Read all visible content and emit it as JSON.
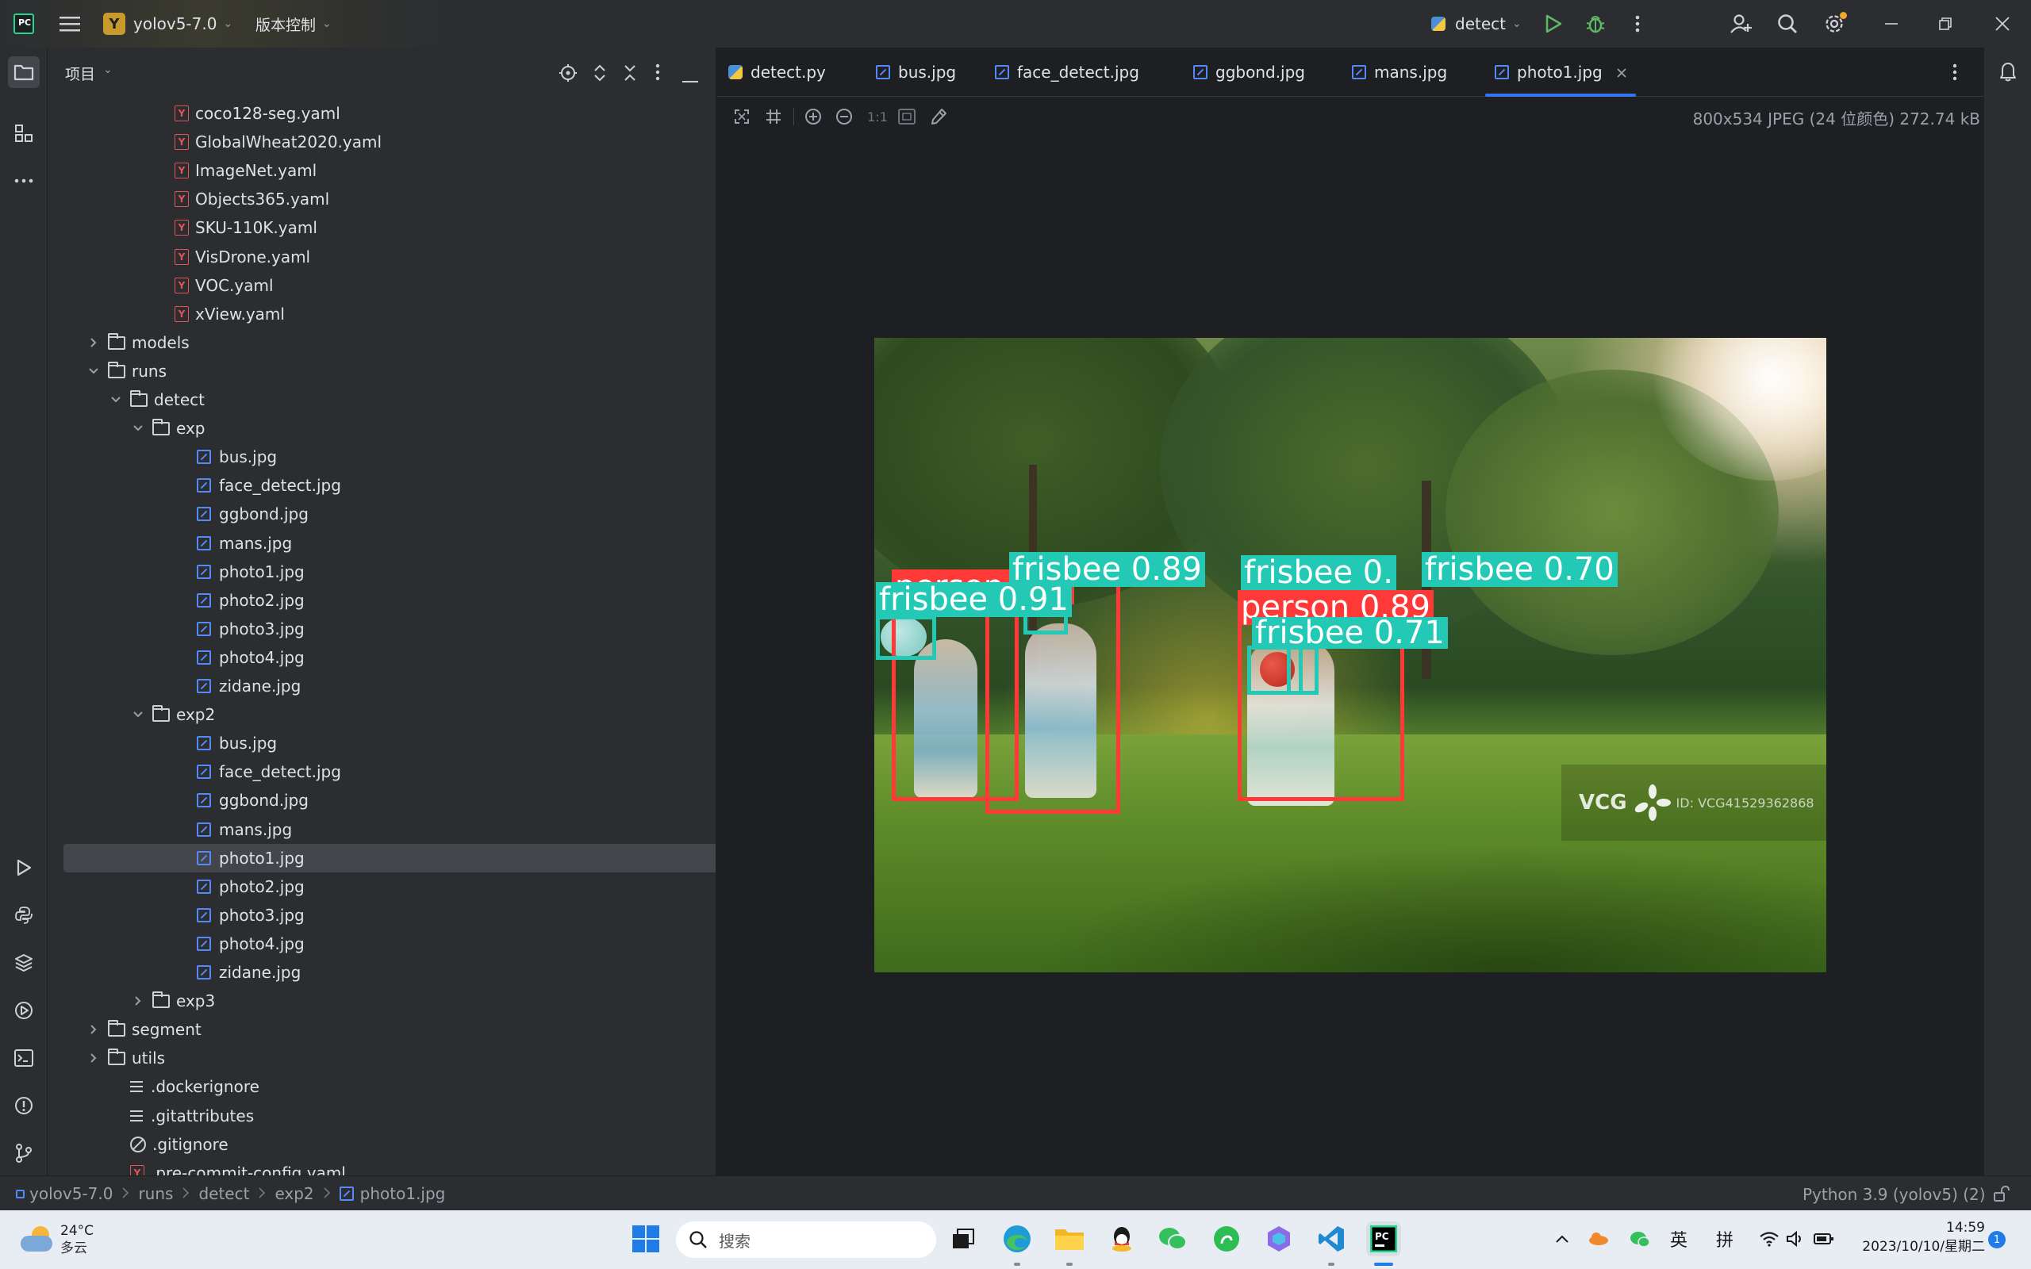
{
  "titlebar": {
    "project_initial": "Y",
    "project_name": "yolov5-7.0",
    "vcs_label": "版本控制",
    "run_config": "detect"
  },
  "project_panel": {
    "title": "项目",
    "tree": [
      {
        "label": "coco128-seg.yaml",
        "type": "yaml",
        "indent": 4
      },
      {
        "label": "GlobalWheat2020.yaml",
        "type": "yaml",
        "indent": 4
      },
      {
        "label": "ImageNet.yaml",
        "type": "yaml",
        "indent": 4
      },
      {
        "label": "Objects365.yaml",
        "type": "yaml",
        "indent": 4
      },
      {
        "label": "SKU-110K.yaml",
        "type": "yaml",
        "indent": 4
      },
      {
        "label": "VisDrone.yaml",
        "type": "yaml",
        "indent": 4
      },
      {
        "label": "VOC.yaml",
        "type": "yaml",
        "indent": 4
      },
      {
        "label": "xView.yaml",
        "type": "yaml",
        "indent": 4
      },
      {
        "label": "models",
        "type": "pkg-folder",
        "indent": 1,
        "expanded": false
      },
      {
        "label": "runs",
        "type": "folder",
        "indent": 1,
        "expanded": true
      },
      {
        "label": "detect",
        "type": "folder",
        "indent": 2,
        "expanded": true
      },
      {
        "label": "exp",
        "type": "folder",
        "indent": 3,
        "expanded": true
      },
      {
        "label": "bus.jpg",
        "type": "image",
        "indent": 5
      },
      {
        "label": "face_detect.jpg",
        "type": "image",
        "indent": 5
      },
      {
        "label": "ggbond.jpg",
        "type": "image",
        "indent": 5
      },
      {
        "label": "mans.jpg",
        "type": "image",
        "indent": 5
      },
      {
        "label": "photo1.jpg",
        "type": "image",
        "indent": 5
      },
      {
        "label": "photo2.jpg",
        "type": "image",
        "indent": 5
      },
      {
        "label": "photo3.jpg",
        "type": "image",
        "indent": 5
      },
      {
        "label": "photo4.jpg",
        "type": "image",
        "indent": 5
      },
      {
        "label": "zidane.jpg",
        "type": "image",
        "indent": 5
      },
      {
        "label": "exp2",
        "type": "folder",
        "indent": 3,
        "expanded": true
      },
      {
        "label": "bus.jpg",
        "type": "image",
        "indent": 5
      },
      {
        "label": "face_detect.jpg",
        "type": "image",
        "indent": 5
      },
      {
        "label": "ggbond.jpg",
        "type": "image",
        "indent": 5
      },
      {
        "label": "mans.jpg",
        "type": "image",
        "indent": 5
      },
      {
        "label": "photo1.jpg",
        "type": "image",
        "indent": 5,
        "selected": true
      },
      {
        "label": "photo2.jpg",
        "type": "image",
        "indent": 5
      },
      {
        "label": "photo3.jpg",
        "type": "image",
        "indent": 5
      },
      {
        "label": "photo4.jpg",
        "type": "image",
        "indent": 5
      },
      {
        "label": "zidane.jpg",
        "type": "image",
        "indent": 5
      },
      {
        "label": "exp3",
        "type": "folder",
        "indent": 3,
        "expanded": false
      },
      {
        "label": "segment",
        "type": "folder",
        "indent": 1,
        "expanded": false
      },
      {
        "label": "utils",
        "type": "pkg-folder",
        "indent": 1,
        "expanded": false
      },
      {
        "label": ".dockerignore",
        "type": "text",
        "indent": 2
      },
      {
        "label": ".gitattributes",
        "type": "text",
        "indent": 2
      },
      {
        "label": ".gitignore",
        "type": "ignore",
        "indent": 2
      },
      {
        "label": ".pre-commit-config.yaml",
        "type": "yaml",
        "indent": 2
      }
    ]
  },
  "tabs": [
    {
      "label": "detect.py",
      "kind": "python"
    },
    {
      "label": "bus.jpg",
      "kind": "image"
    },
    {
      "label": "face_detect.jpg",
      "kind": "image"
    },
    {
      "label": "ggbond.jpg",
      "kind": "image"
    },
    {
      "label": "mans.jpg",
      "kind": "image"
    },
    {
      "label": "photo1.jpg",
      "kind": "image",
      "active": true
    }
  ],
  "viewer": {
    "zoom_actual": "1:1",
    "image_info": "800x534 JPEG (24 位颜色) 272.74 kB",
    "detections": [
      {
        "label": "person",
        "color": "red"
      },
      {
        "label": "frisbee  0.89",
        "color": "cyan"
      },
      {
        "label": "frisbee  0.91",
        "color": "cyan"
      },
      {
        "label": "frisbee  0.",
        "color": "cyan"
      },
      {
        "label": "frisbee  0.70",
        "color": "cyan"
      },
      {
        "label": "person  0.89",
        "color": "red"
      },
      {
        "label": "frisbee  0.71",
        "color": "cyan"
      }
    ],
    "watermark_brand": "VCG",
    "watermark_id": "ID: VCG41529362868"
  },
  "statusbar": {
    "breadcrumb": [
      "yolov5-7.0",
      "runs",
      "detect",
      "exp2",
      "photo1.jpg"
    ],
    "interpreter": "Python 3.9 (yolov5) (2)"
  },
  "taskbar": {
    "temperature": "24°C",
    "weather": "多云",
    "search_placeholder": "搜索",
    "ime_lang": "英",
    "ime_mode": "拼",
    "time": "14:59",
    "date": "2023/10/10/星期二",
    "notification_count": "1"
  },
  "colors": {
    "accent": "#3574f0",
    "bbox_red": "#ff3838",
    "bbox_cyan": "#23c9b4",
    "panel_bg": "#2b2d30",
    "editor_bg": "#1e1f22"
  }
}
